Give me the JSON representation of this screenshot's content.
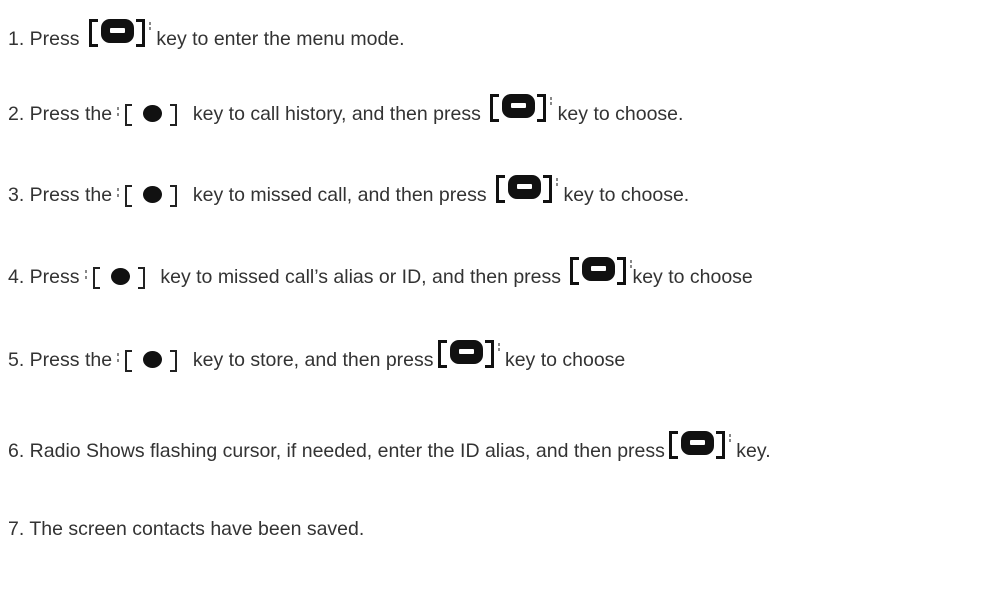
{
  "steps": [
    {
      "parts": [
        {
          "type": "text",
          "value": "1. Press "
        },
        {
          "type": "key",
          "key": "menu-key-icon"
        },
        {
          "type": "text",
          "value": " key to enter the menu mode."
        }
      ]
    },
    {
      "parts": [
        {
          "type": "text",
          "value": "2. Press the "
        },
        {
          "type": "key",
          "key": "navigation-key-icon"
        },
        {
          "type": "text",
          "value": " key to call history, and then press "
        },
        {
          "type": "key",
          "key": "menu-key-icon"
        },
        {
          "type": "text",
          "value": " key to choose."
        }
      ]
    },
    {
      "parts": [
        {
          "type": "text",
          "value": "3. Press the "
        },
        {
          "type": "key",
          "key": "navigation-key-icon"
        },
        {
          "type": "text",
          "value": " key to missed call, and then press "
        },
        {
          "type": "key",
          "key": "menu-key-icon"
        },
        {
          "type": "text",
          "value": " key to choose."
        }
      ]
    },
    {
      "parts": [
        {
          "type": "text",
          "value": "4. Press "
        },
        {
          "type": "key",
          "key": "navigation-key-icon"
        },
        {
          "type": "text",
          "value": " key to missed call’s alias or ID, and then press "
        },
        {
          "type": "key",
          "key": "menu-key-icon"
        },
        {
          "type": "text",
          "value": "key to choose"
        }
      ]
    },
    {
      "parts": [
        {
          "type": "text",
          "value": "5. Press the "
        },
        {
          "type": "key",
          "key": "navigation-key-icon"
        },
        {
          "type": "text",
          "value": " key to store, and then press"
        },
        {
          "type": "key",
          "key": "menu-key-icon"
        },
        {
          "type": "text",
          "value": " key to choose"
        }
      ]
    },
    {
      "parts": [
        {
          "type": "text",
          "value": "6. Radio Shows flashing cursor, if needed, enter the ID alias, and then press"
        },
        {
          "type": "key",
          "key": "menu-key-icon"
        },
        {
          "type": "text",
          "value": " key."
        }
      ]
    },
    {
      "parts": [
        {
          "type": "text",
          "value": "7. The screen contacts have been saved."
        }
      ]
    }
  ]
}
